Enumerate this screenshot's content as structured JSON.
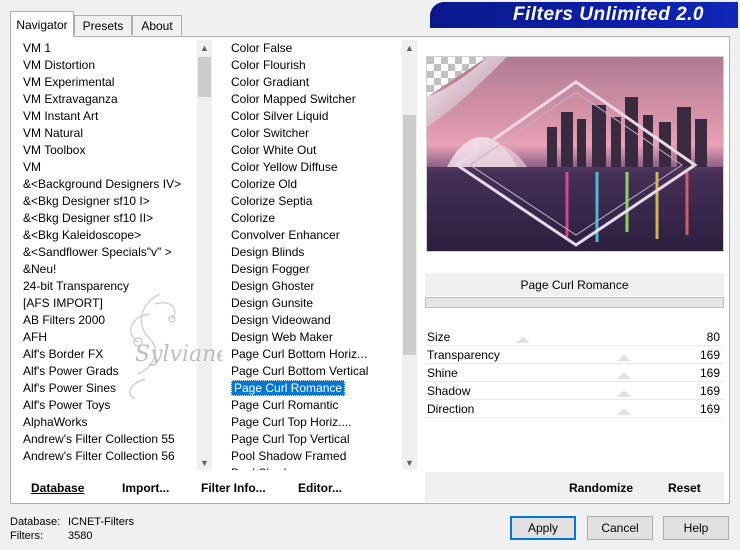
{
  "tabs": {
    "navigator": "Navigator",
    "presets": "Presets",
    "about": "About"
  },
  "banner_title": "Filters Unlimited 2.0",
  "categories": [
    "VM 1",
    "VM Distortion",
    "VM Experimental",
    "VM Extravaganza",
    "VM Instant Art",
    "VM Natural",
    "VM Toolbox",
    "VM",
    "&<Background Designers IV>",
    "&<Bkg Designer sf10 I>",
    "&<Bkg Designer sf10 II>",
    "&<Bkg Kaleidoscope>",
    "&<Sandflower Specials\"v\" >",
    "&Neu!",
    "24-bit Transparency",
    "[AFS IMPORT]",
    "AB Filters 2000",
    "AFH",
    "Alf's Border FX",
    "Alf's Power Grads",
    "Alf's Power Sines",
    "Alf's Power Toys",
    "AlphaWorks",
    "Andrew's Filter Collection 55",
    "Andrew's Filter Collection 56"
  ],
  "filters": [
    "Color False",
    "Color Flourish",
    "Color Gradiant",
    "Color Mapped Switcher",
    "Color Silver Liquid",
    "Color Switcher",
    "Color White Out",
    "Color Yellow Diffuse",
    "Colorize Old",
    "Colorize Septia",
    "Colorize",
    "Convolver Enhancer",
    "Design Blinds",
    "Design Fogger",
    "Design Ghoster",
    "Design Gunsite",
    "Design Videowand",
    "Design Web Maker",
    "Page Curl Bottom Horiz...",
    "Page Curl Bottom Vertical",
    "Page Curl Romance",
    "Page Curl Romantic",
    "Page Curl Top Horiz....",
    "Page Curl Top Vertical",
    "Pool Shadow Framed",
    "Pool Shadow"
  ],
  "selected_filter": "Page Curl Romance",
  "filter_name": "Page Curl Romance",
  "params": [
    {
      "label": "Size",
      "value": "80"
    },
    {
      "label": "Transparency",
      "value": "169"
    },
    {
      "label": "Shine",
      "value": "169"
    },
    {
      "label": "Shadow",
      "value": "169"
    },
    {
      "label": "Direction",
      "value": "169"
    }
  ],
  "buttons": {
    "database": "Database",
    "import": "Import...",
    "filter_info": "Filter Info...",
    "editor": "Editor...",
    "randomize": "Randomize",
    "reset": "Reset",
    "apply": "Apply",
    "cancel": "Cancel",
    "help": "Help"
  },
  "status": {
    "database_label": "Database:",
    "database_value": "ICNET-Filters",
    "filters_label": "Filters:",
    "filters_value": "3580"
  },
  "watermark": "Sylviane",
  "colors": {
    "banner": "#0b1ea8",
    "selection": "#0078d7"
  },
  "icons": {
    "scroll_up": "chevron-up-icon",
    "scroll_down": "chevron-down-icon"
  }
}
